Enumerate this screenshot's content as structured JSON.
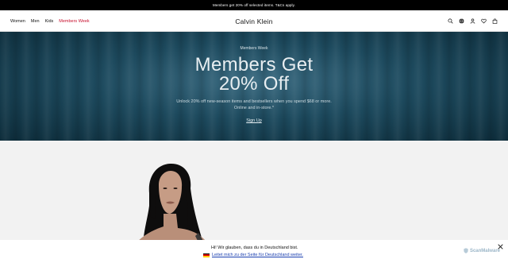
{
  "promo_bar": {
    "text": "Members get 20% off selected items. T&Cs apply."
  },
  "header": {
    "nav": [
      {
        "label": "Women",
        "sale": false
      },
      {
        "label": "Men",
        "sale": false
      },
      {
        "label": "Kids",
        "sale": false
      },
      {
        "label": "Members Week",
        "sale": true
      }
    ],
    "logo": "Calvin Klein",
    "icons": [
      "search-icon",
      "globe-icon",
      "account-icon",
      "wishlist-icon",
      "bag-icon"
    ]
  },
  "hero": {
    "eyebrow": "Members Week",
    "headline_line1": "Members Get",
    "headline_line2": "20% Off",
    "copy": "Unlock 20% off new-season items and bestsellers when you spend $68 or more. Online and in-store.*",
    "cta": "Sign Up"
  },
  "geo_banner": {
    "text": "Hi! Wir glauben, dass du in Deutschland bist.",
    "link": "Leitet mich zu der Seite für Deutschland weiter.",
    "flag_colors": [
      "#000000",
      "#dd0000",
      "#ffce00"
    ]
  },
  "watermark": {
    "text": "ScanMalware"
  },
  "colors": {
    "sale": "#c8102e",
    "hero": "#1d4a5e",
    "link": "#1a3fb0"
  }
}
